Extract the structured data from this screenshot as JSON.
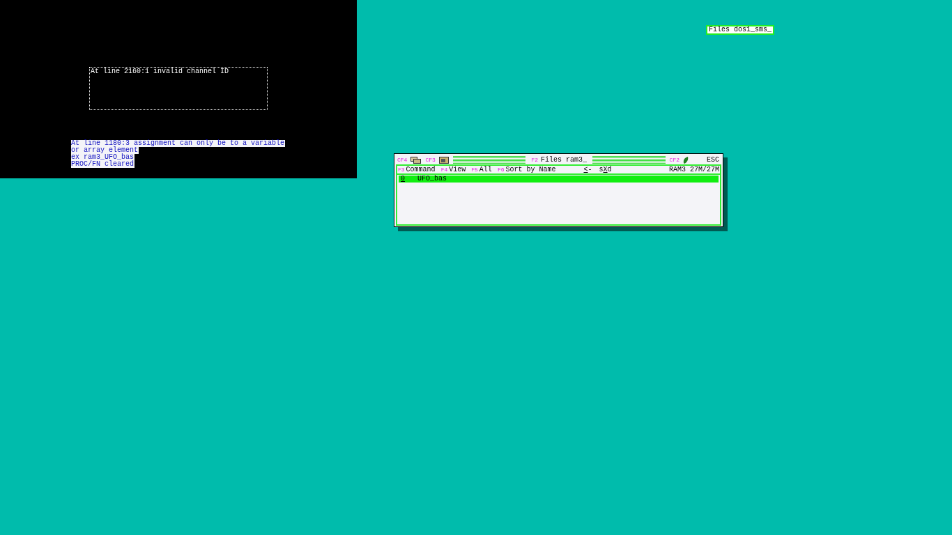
{
  "console": {
    "error_box": "At line 2160:1 invalid channel ID",
    "messages": [
      "At line 1180:3 assignment can only be to a variable",
      "or array element",
      "ex ram3_UFO_bas",
      "PROC/FN cleared"
    ]
  },
  "files_window": {
    "title_bar": {
      "left_keys": [
        {
          "key": "CF4",
          "kind": "windows"
        },
        {
          "key": "CF3",
          "kind": "box"
        }
      ],
      "title_key": "F2",
      "title": "Files ram3_",
      "right_keys": [
        {
          "key": "CF2",
          "kind": "leaf"
        }
      ],
      "escape": "ESC"
    },
    "menu": [
      {
        "key": "F3",
        "label": "Command"
      },
      {
        "key": "F4",
        "label": "View"
      },
      {
        "key": "F5",
        "label": "All"
      },
      {
        "key": "F6",
        "label": "Sort by Name"
      }
    ],
    "nav": [
      {
        "hotkey": "<",
        "after": "-"
      },
      {
        "before": "s",
        "hotkey": "X",
        "after": "d"
      }
    ],
    "drive": "RAM3 27M/27M",
    "files": [
      {
        "number": "0",
        "name": "UFO_bas",
        "selected": true
      }
    ]
  },
  "mini_window": {
    "title": "Files dos1_sms_"
  }
}
